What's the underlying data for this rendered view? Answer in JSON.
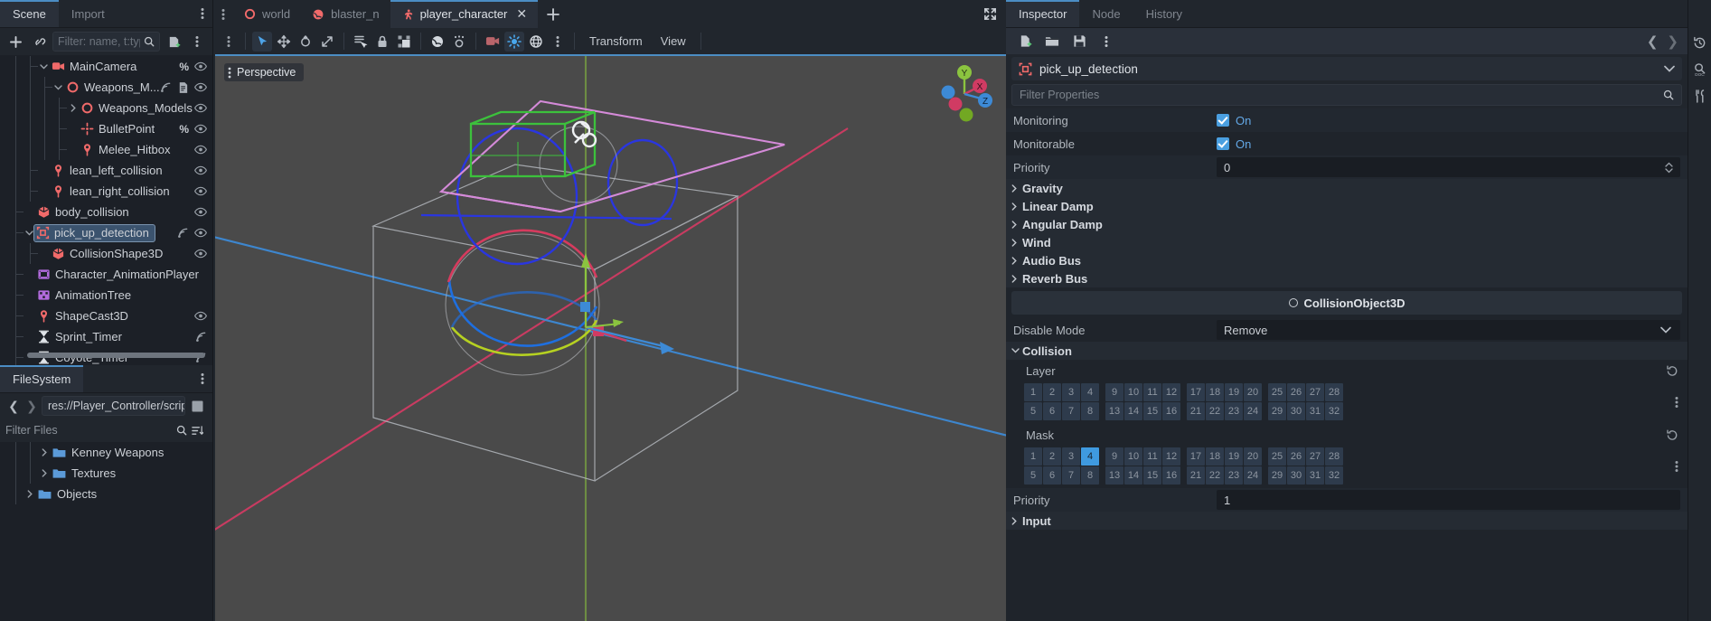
{
  "scene_dock": {
    "tabs": [
      {
        "label": "Scene",
        "active": true
      },
      {
        "label": "Import",
        "active": false
      }
    ],
    "toolbar": {
      "add_icon": "plus-icon",
      "link_icon": "link-icon",
      "filter_placeholder": "Filter: name, t:typ",
      "search_icon": "search-icon",
      "script_icon": "attach-script-icon",
      "menu_icon": "kebab-menu-icon"
    },
    "tree": [
      {
        "label": "MainCamera",
        "icon": "camera-icon",
        "indent": 3,
        "expander": "down",
        "badges": [
          "%"
        ],
        "eye": true
      },
      {
        "label": "Weapons_M...",
        "icon": "area3d-icon",
        "indent": 4,
        "expander": "down",
        "badges": [
          "signal",
          "script"
        ],
        "eye": true
      },
      {
        "label": "Weapons_Models",
        "icon": "area3d-icon",
        "indent": 5,
        "expander": "right",
        "badges": [],
        "eye": true
      },
      {
        "label": "BulletPoint",
        "icon": "marker3d-icon",
        "indent": 5,
        "expander": "none",
        "badges": [
          "%"
        ],
        "eye": true
      },
      {
        "label": "Melee_Hitbox",
        "icon": "pin-icon",
        "indent": 5,
        "expander": "none",
        "badges": [],
        "eye": true
      },
      {
        "label": "lean_left_collision",
        "icon": "pin-icon",
        "indent": 3,
        "expander": "none",
        "badges": [],
        "eye": true
      },
      {
        "label": "lean_right_collision",
        "icon": "pin-icon",
        "indent": 3,
        "expander": "none",
        "badges": [],
        "eye": true
      },
      {
        "label": "body_collision",
        "icon": "collisionshape-icon",
        "indent": 2,
        "expander": "none",
        "badges": [],
        "eye": true
      },
      {
        "label": "pick_up_detection",
        "icon": "area3d-box-icon",
        "indent": 2,
        "expander": "down",
        "badges": [
          "signal"
        ],
        "eye": true,
        "selected": true
      },
      {
        "label": "CollisionShape3D",
        "icon": "collisionshape-icon",
        "indent": 3,
        "expander": "none",
        "badges": [],
        "eye": true
      },
      {
        "label": "Character_AnimationPlayer",
        "icon": "animationplayer-icon",
        "indent": 2,
        "expander": "none",
        "badges": [],
        "eye": false
      },
      {
        "label": "AnimationTree",
        "icon": "animationtree-icon",
        "indent": 2,
        "expander": "none",
        "badges": [],
        "eye": false
      },
      {
        "label": "ShapeCast3D",
        "icon": "pin-icon",
        "indent": 2,
        "expander": "none",
        "badges": [],
        "eye": true
      },
      {
        "label": "Sprint_Timer",
        "icon": "timer-icon",
        "indent": 2,
        "expander": "none",
        "badges": [
          "signal"
        ],
        "eye": false
      },
      {
        "label": "Coyote_Timer",
        "icon": "timer-icon",
        "indent": 2,
        "expander": "none",
        "badges": [
          "signal"
        ],
        "eye": false
      }
    ]
  },
  "filesystem_dock": {
    "tabs": [
      {
        "label": "FileSystem",
        "active": true
      }
    ],
    "menu_icon": "kebab-menu-icon",
    "back_icon": "chevron-left-icon",
    "forward_icon": "chevron-right-icon",
    "path": "res://Player_Controller/script",
    "split_icon": "split-view-icon",
    "filter_placeholder": "Filter Files",
    "search_icon": "search-icon",
    "sort_icon": "sort-icon",
    "items": [
      {
        "label": "Kenney Weapons",
        "indent": 3,
        "expander": "right"
      },
      {
        "label": "Textures",
        "indent": 3,
        "expander": "right"
      },
      {
        "label": "Objects",
        "indent": 2,
        "expander": "right"
      }
    ]
  },
  "scene_tabs": {
    "menu_icon": "kebab-menu-icon",
    "add_icon": "plus-icon",
    "tabs": [
      {
        "label": "world",
        "icon": "node3d-icon",
        "active": false,
        "closable": false
      },
      {
        "label": "blaster_n",
        "icon": "mesh-icon",
        "active": false,
        "closable": false
      },
      {
        "label": "player_character",
        "icon": "characterbody3d-icon",
        "active": true,
        "closable": true,
        "close_icon": "close-icon"
      }
    ]
  },
  "viewport_toolbar": {
    "menu_icon": "kebab-menu-icon",
    "tools": [
      {
        "name": "select-tool",
        "icon": "cursor-icon",
        "active": true
      },
      {
        "name": "move-tool",
        "icon": "move-icon",
        "active": false
      },
      {
        "name": "rotate-tool",
        "icon": "rotate-icon",
        "active": false
      },
      {
        "name": "scale-tool",
        "icon": "scale-icon",
        "active": false
      },
      {
        "name": "list-select-tool",
        "icon": "list-select-icon",
        "active": false
      },
      {
        "name": "lock-tool",
        "icon": "lock-icon",
        "active": false
      },
      {
        "name": "group-tool",
        "icon": "group-icon",
        "active": false
      },
      {
        "name": "local-space-tool",
        "icon": "local-space-icon",
        "active": false
      },
      {
        "name": "snap-tool",
        "icon": "snap-icon",
        "active": false
      },
      {
        "name": "camera-preview",
        "icon": "camera-icon",
        "active": false
      },
      {
        "name": "preview-sun",
        "icon": "sun-icon",
        "active": true
      },
      {
        "name": "preview-environment",
        "icon": "globe-icon",
        "active": false
      },
      {
        "name": "viewport-options",
        "icon": "kebab-menu-icon",
        "active": false
      }
    ],
    "menus": [
      {
        "label": "Transform"
      },
      {
        "label": "View"
      }
    ]
  },
  "viewport": {
    "perspective_label": "Perspective",
    "perspective_menu_icon": "kebab-menu-icon",
    "maximize_icon": "maximize-icon",
    "gizmo_axes": [
      "Y",
      "X",
      "Z"
    ],
    "colors": {
      "x_axis": "#d03b63",
      "y_axis": "#8bc43f",
      "z_axis": "#3d8ad6",
      "background": "#4a4a4a",
      "collision_shape": "#2a36e0",
      "area_gizmo": "#c77ad0",
      "mesh_green": "#3cc13c"
    }
  },
  "inspector": {
    "tabs": [
      {
        "label": "Inspector",
        "active": true
      },
      {
        "label": "Node",
        "active": false
      },
      {
        "label": "History",
        "active": false
      }
    ],
    "toolbar": {
      "new_resource_icon": "new-resource-icon",
      "load_icon": "folder-open-icon",
      "save_icon": "save-icon",
      "tools_icon": "kebab-menu-icon",
      "back_icon": "chevron-left-icon",
      "forward_icon": "chevron-right-icon",
      "history_icon": "history-icon"
    },
    "node_name": "pick_up_detection",
    "node_icon": "area3d-box-icon",
    "node_dropdown_icon": "chevron-down-icon",
    "filter_placeholder": "Filter Properties",
    "filter_search_icon": "search-icon",
    "filter_expand_icon": "expand-all-icon",
    "properties": [
      {
        "type": "check",
        "name": "Monitoring",
        "value": "On",
        "checked": true
      },
      {
        "type": "check",
        "name": "Monitorable",
        "value": "On",
        "checked": true
      },
      {
        "type": "number",
        "name": "Priority",
        "value": "0",
        "spinner_icon": "spinner-icon"
      },
      {
        "type": "group",
        "name": "Gravity",
        "expanded": false
      },
      {
        "type": "group",
        "name": "Linear Damp",
        "expanded": false
      },
      {
        "type": "group",
        "name": "Angular Damp",
        "expanded": false
      },
      {
        "type": "group",
        "name": "Wind",
        "expanded": false
      },
      {
        "type": "group",
        "name": "Audio Bus",
        "expanded": false
      },
      {
        "type": "group",
        "name": "Reverb Bus",
        "expanded": false
      },
      {
        "type": "category",
        "name": "CollisionObject3D",
        "icon": "collisionobject3d-icon"
      },
      {
        "type": "dropdown",
        "name": "Disable Mode",
        "value": "Remove",
        "chevron_icon": "chevron-down-icon"
      },
      {
        "type": "group",
        "name": "Collision",
        "expanded": true
      },
      {
        "type": "bitgrid",
        "name": "Layer",
        "selected": [],
        "reset_icon": "reset-icon",
        "menu_icon": "kebab-menu-icon"
      },
      {
        "type": "bitgrid",
        "name": "Mask",
        "selected": [
          4
        ],
        "reset_icon": "reset-icon",
        "menu_icon": "kebab-menu-icon"
      },
      {
        "type": "number",
        "name": "Priority",
        "value": "1"
      },
      {
        "type": "group",
        "name": "Input",
        "expanded": false
      }
    ],
    "bit_labels": [
      1,
      2,
      3,
      4,
      5,
      6,
      7,
      8,
      9,
      10,
      11,
      12,
      13,
      14,
      15,
      16,
      17,
      18,
      19,
      20,
      21,
      22,
      23,
      24,
      25,
      26,
      27,
      28,
      29,
      30,
      31,
      32
    ]
  },
  "right_strip": {
    "icons": [
      "history-icon",
      "search-docs-icon",
      "tools-icon"
    ]
  }
}
